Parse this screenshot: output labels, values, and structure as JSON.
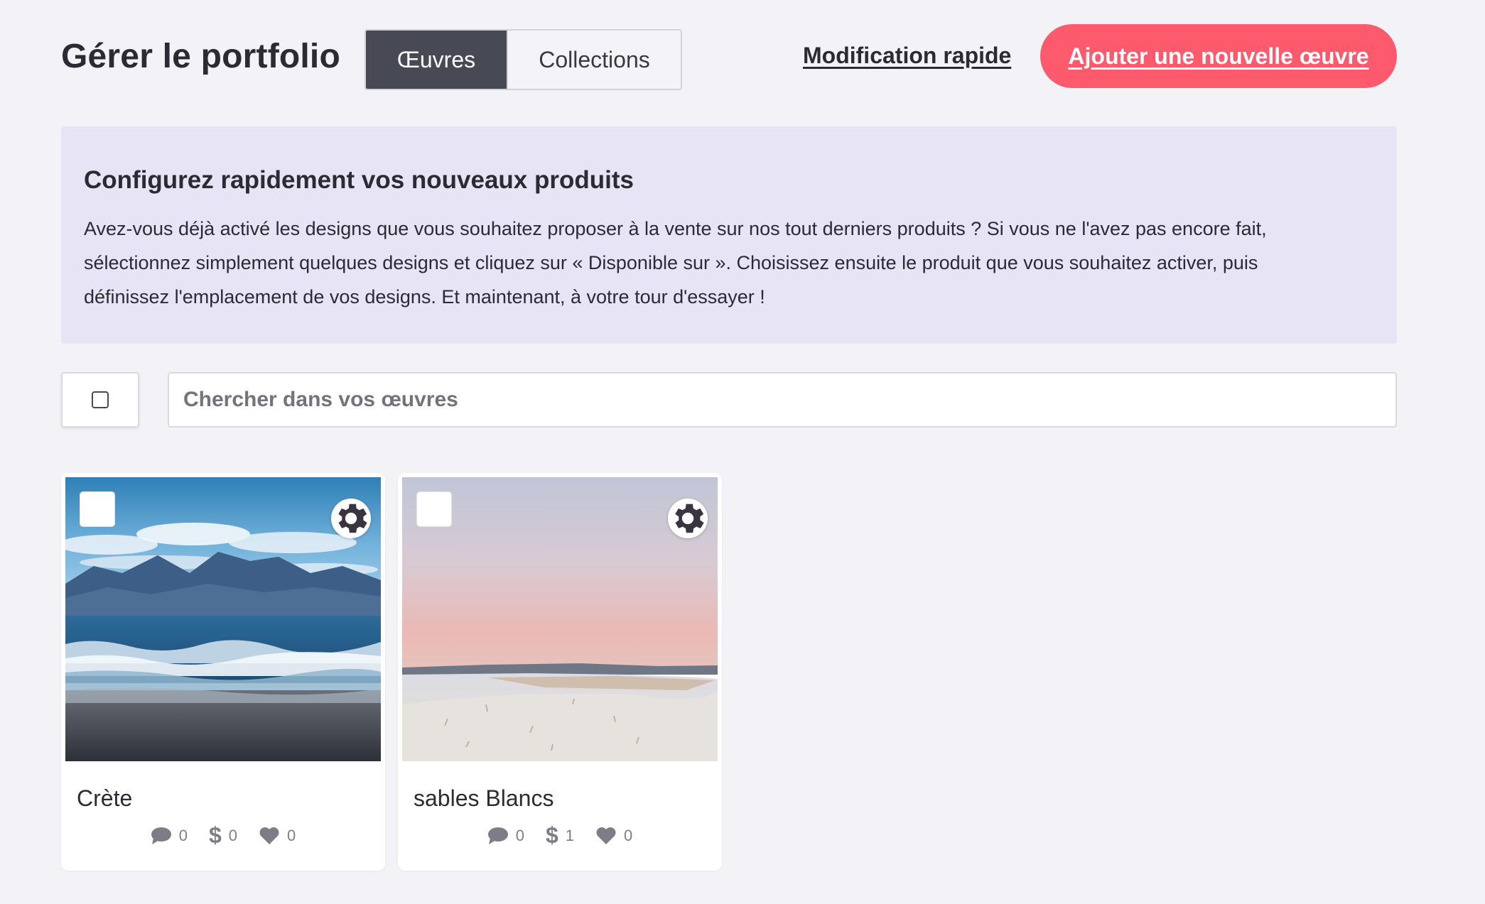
{
  "header": {
    "title": "Gérer le portfolio",
    "tabs": [
      {
        "label": "Œuvres",
        "active": true
      },
      {
        "label": "Collections",
        "active": false
      }
    ],
    "quick_edit_label": "Modification rapide",
    "add_button_label": "Ajouter une nouvelle œuvre"
  },
  "banner": {
    "title": "Configurez rapidement vos nouveaux produits",
    "lines": [
      "Avez-vous déjà activé les designs que vous souhaitez proposer à la vente sur nos tout derniers produits ? Si vous ne l'avez pas encore fait,",
      "sélectionnez simplement quelques designs et cliquez sur « Disponible sur ». Choisissez ensuite le produit que vous souhaitez activer, puis",
      "définissez l'emplacement de vos designs. Et maintenant, à votre tour d'essayer !"
    ]
  },
  "search": {
    "placeholder": "Chercher dans vos œuvres",
    "value": ""
  },
  "works": [
    {
      "title": "Crète",
      "comments": "0",
      "sales": "0",
      "likes": "0"
    },
    {
      "title": "sables Blancs",
      "comments": "0",
      "sales": "1",
      "likes": "0"
    }
  ],
  "icons": {
    "settings": "gear-icon",
    "private": "lock-icon",
    "comments": "comment-icon",
    "sales": "dollar-icon",
    "likes": "heart-icon"
  },
  "colors": {
    "accent": "#fd5a6e",
    "active_tab": "#474a55",
    "banner_bg": "#e7e4f6",
    "page_bg": "#f2f2f7"
  }
}
